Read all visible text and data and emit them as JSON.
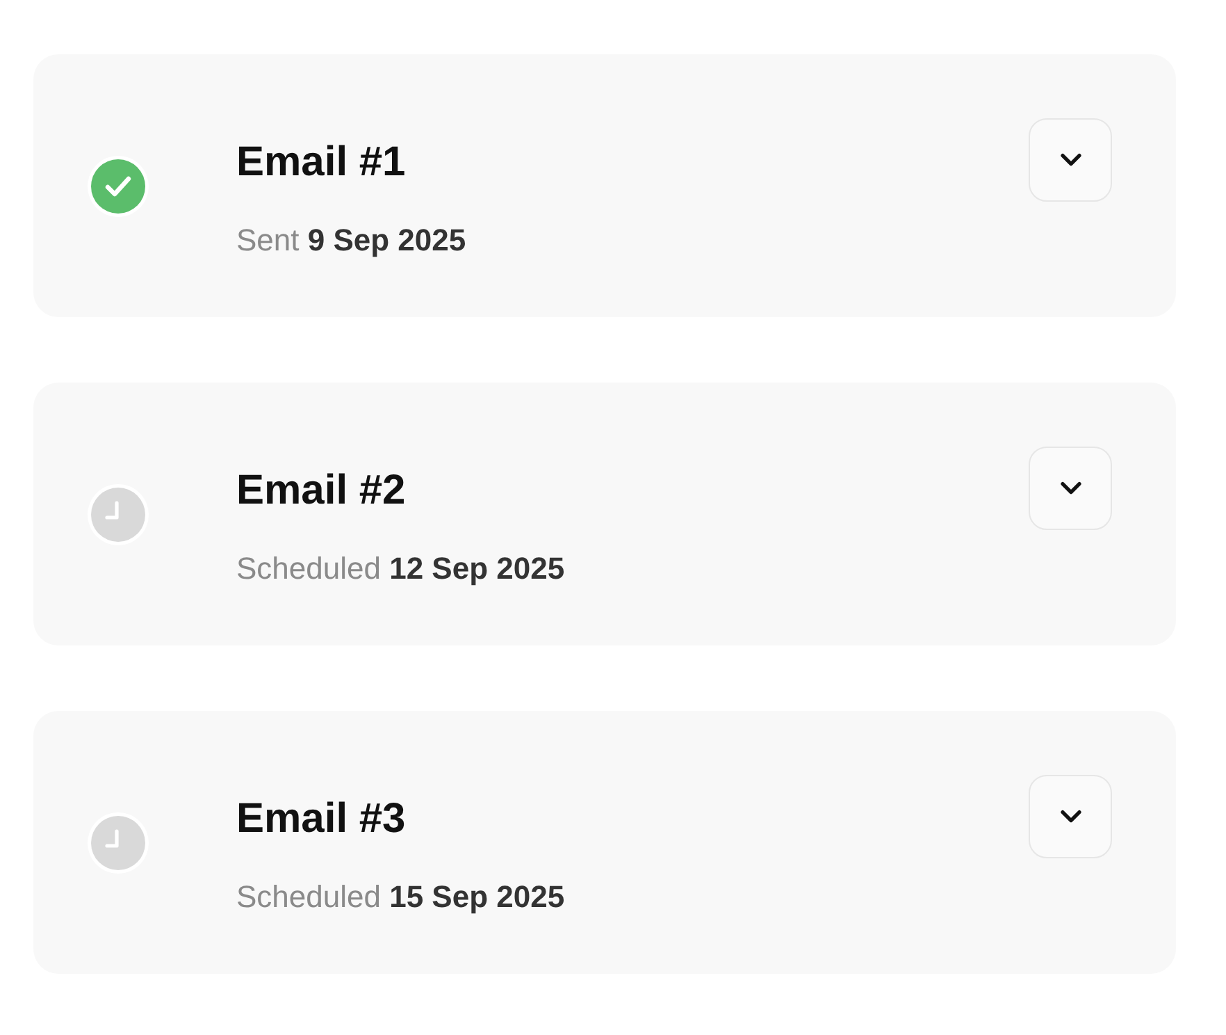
{
  "emails": [
    {
      "title": "Email #1",
      "kind": "done",
      "subtitle": "Sent **9 Sep 2025**",
      "expanded": false
    },
    {
      "title": "Email #2",
      "kind": "pending",
      "subtitle": "Scheduled **12 Sep 2025**",
      "expanded": false
    },
    {
      "title": "Email #3",
      "kind": "pending",
      "subtitle": "Scheduled **15 Sep 2025**",
      "expanded": false
    }
  ]
}
